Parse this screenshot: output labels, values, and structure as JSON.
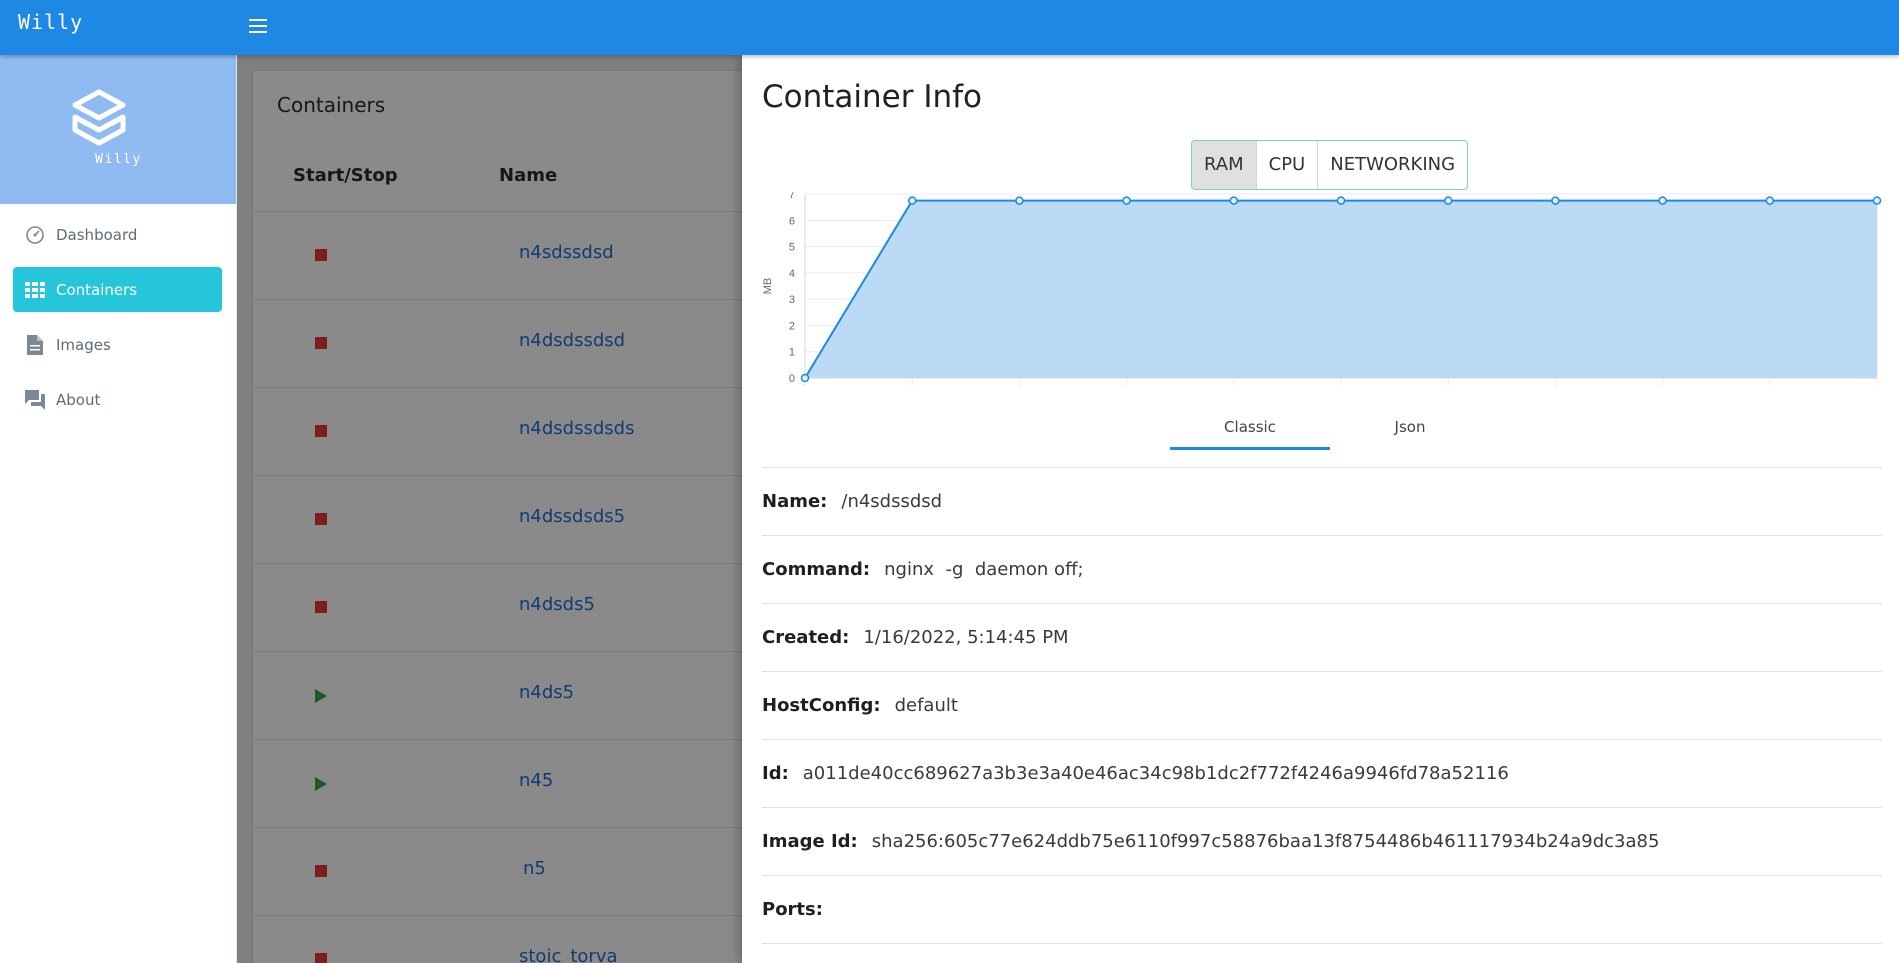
{
  "app": {
    "title": "Willy",
    "brand_name": "Willy"
  },
  "sidebar": {
    "items": [
      {
        "label": "Dashboard",
        "icon": "dashboard-icon",
        "active": false
      },
      {
        "label": "Containers",
        "icon": "grid-icon",
        "active": true
      },
      {
        "label": "Images",
        "icon": "file-icon",
        "active": false
      },
      {
        "label": "About",
        "icon": "chat-icon",
        "active": false
      }
    ]
  },
  "containers_page": {
    "title": "Containers",
    "columns": [
      "Start/Stop",
      "Name"
    ],
    "rows": [
      {
        "name": "n4sdssdsd",
        "state": "stop"
      },
      {
        "name": "n4dsdssdsd",
        "state": "stop"
      },
      {
        "name": "n4dsdssdsds",
        "state": "stop"
      },
      {
        "name": "n4dssdsds5",
        "state": "stop"
      },
      {
        "name": "n4dsds5",
        "state": "stop"
      },
      {
        "name": "n4ds5",
        "state": "play"
      },
      {
        "name": "n45",
        "state": "play"
      },
      {
        "name": "n5",
        "state": "stop"
      },
      {
        "name": "stoic_torva",
        "state": "stop"
      }
    ]
  },
  "drawer": {
    "title": "Container Info",
    "segments": [
      "RAM",
      "CPU",
      "NETWORKING"
    ],
    "active_segment": "RAM",
    "tabs": [
      "Classic",
      "Json"
    ],
    "active_tab": "Classic",
    "info": [
      {
        "label": "Name:",
        "value": "/n4sdssdsd"
      },
      {
        "label": "Command:",
        "value": "nginx  -g  daemon off;"
      },
      {
        "label": "Created:",
        "value": "1/16/2022, 5:14:45 PM"
      },
      {
        "label": "HostConfig:",
        "value": "default"
      },
      {
        "label": "Id:",
        "value": "a011de40cc689627a3b3e3a40e46ac34c98b1dc2f772f4246a9946fd78a52116"
      },
      {
        "label": "Image Id:",
        "value": "sha256:605c77e624ddb75e6110f997c58876baa13f8754486b461117934b24a9dc3a85"
      },
      {
        "label": "Ports:",
        "value": ""
      }
    ]
  },
  "colors": {
    "topbar": "#1e88e5",
    "sidebar_active": "#26c6da",
    "chart_line": "#1e88e5",
    "chart_fill": "#bbdaf5",
    "stop": "#e53935",
    "play": "#43a047"
  },
  "chart_data": {
    "type": "area",
    "ylabel": "MB",
    "xlabel": "",
    "ylim": [
      0,
      7
    ],
    "yticks": [
      0,
      1,
      2,
      3,
      4,
      5,
      6,
      7
    ],
    "x": [
      0,
      1,
      2,
      3,
      4,
      5,
      6,
      7,
      8,
      9,
      10
    ],
    "series": [
      {
        "values": [
          0,
          6.75,
          6.75,
          6.75,
          6.75,
          6.75,
          6.75,
          6.75,
          6.75,
          6.75,
          6.75
        ]
      }
    ],
    "grid": true
  }
}
